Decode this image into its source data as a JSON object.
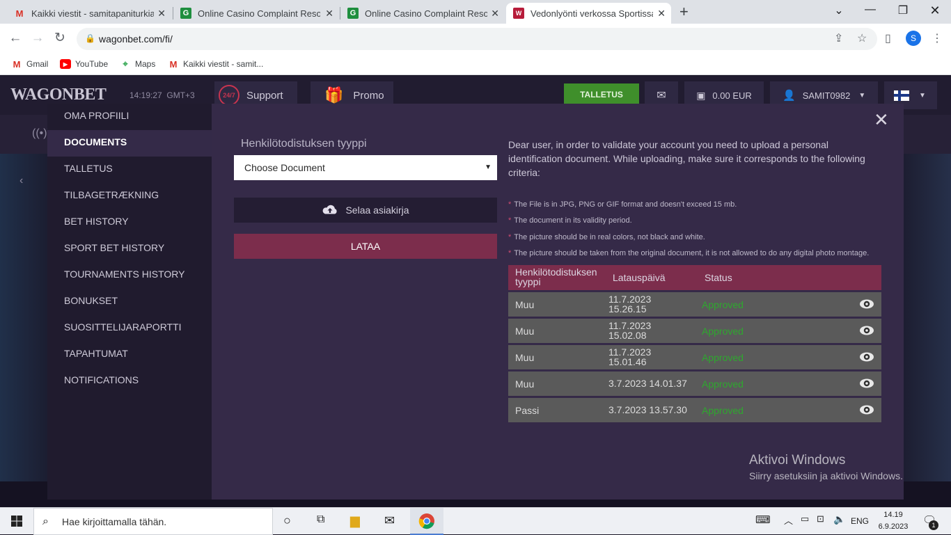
{
  "browser": {
    "tabs": [
      {
        "title": "Kaikki viestit - samitapaniturkia@",
        "favicon": "gmail-icon"
      },
      {
        "title": "Online Casino Complaint Resolut",
        "favicon": "casinoguru-icon"
      },
      {
        "title": "Online Casino Complaint Resolut",
        "favicon": "casinoguru-icon"
      },
      {
        "title": "Vedonlyönti verkossa Sportissa W",
        "favicon": "wagonbet-icon",
        "active": true
      }
    ],
    "new_tab": "+",
    "url": "wagonbet.com/fi/",
    "profile_initial": "S",
    "bookmarks": [
      {
        "label": "Gmail",
        "icon": "gmail-icon"
      },
      {
        "label": "YouTube",
        "icon": "youtube-icon"
      },
      {
        "label": "Maps",
        "icon": "maps-icon"
      },
      {
        "label": "Kaikki viestit - samit...",
        "icon": "gmail-icon"
      }
    ]
  },
  "site": {
    "logo": "WAGONBET",
    "time": "14:19:27",
    "timezone": "GMT+3",
    "support": "Support",
    "support_badge": "24/7",
    "promo": "Promo",
    "deposit": "TALLETUS",
    "balance": "0.00 EUR",
    "username": "SAMIT0982",
    "language_flag": "finland-flag-icon"
  },
  "modal": {
    "menu": [
      {
        "label": "OMA PROFIILI"
      },
      {
        "label": "DOCUMENTS",
        "active": true
      },
      {
        "label": "TALLETUS"
      },
      {
        "label": "TILBAGETRÆKNING"
      },
      {
        "label": "BET HISTORY"
      },
      {
        "label": "SPORT BET HISTORY"
      },
      {
        "label": "TOURNAMENTS HISTORY"
      },
      {
        "label": "BONUKSET"
      },
      {
        "label": "SUOSITTELIJARAPORTTI"
      },
      {
        "label": "TAPAHTUMAT"
      },
      {
        "label": "NOTIFICATIONS"
      }
    ],
    "doc_type_label": "Henkilötodistuksen tyyppi",
    "doc_select_value": "Choose Document",
    "browse_label": "Selaa asiakirja",
    "upload_label": "LATAA",
    "intro": "Dear user, in order to validate your account you need to upload a personal identification document. While uploading, make sure it corresponds to the following criteria:",
    "criteria": [
      "The File is in JPG, PNG or GIF format and doesn't exceed 15 mb.",
      "The document in its validity period.",
      "The picture should be in real colors, not black and white.",
      "The picture should be taken from the original document, it is not allowed to do any digital photo montage."
    ],
    "criteria_bullet": "*",
    "table": {
      "headers": [
        "Henkilötodistuksen tyyppi",
        "Latauspäivä",
        "Status"
      ],
      "rows": [
        {
          "type": "Muu",
          "date": "11.7.2023",
          "time": "15.26.15",
          "status": "Approved"
        },
        {
          "type": "Muu",
          "date": "11.7.2023",
          "time": "15.02.08",
          "status": "Approved"
        },
        {
          "type": "Muu",
          "date": "11.7.2023",
          "time": "15.01.46",
          "status": "Approved"
        },
        {
          "type": "Muu",
          "date": "3.7.2023 14.01.37",
          "time": "",
          "status": "Approved"
        },
        {
          "type": "Passi",
          "date": "3.7.2023 13.57.30",
          "time": "",
          "status": "Approved"
        }
      ]
    }
  },
  "windows": {
    "activate_title": "Aktivoi Windows",
    "activate_sub": "Siirry asetuksiin ja aktivoi Windows.",
    "search_placeholder": "Hae kirjoittamalla tähän.",
    "language": "ENG",
    "clock_time": "14.19",
    "clock_date": "6.9.2023",
    "notification_count": "1"
  },
  "colors": {
    "accent": "#7c2d4c",
    "approved": "#2ea82e",
    "deposit": "#3f8f2b",
    "modal_bg": "#352a48"
  }
}
